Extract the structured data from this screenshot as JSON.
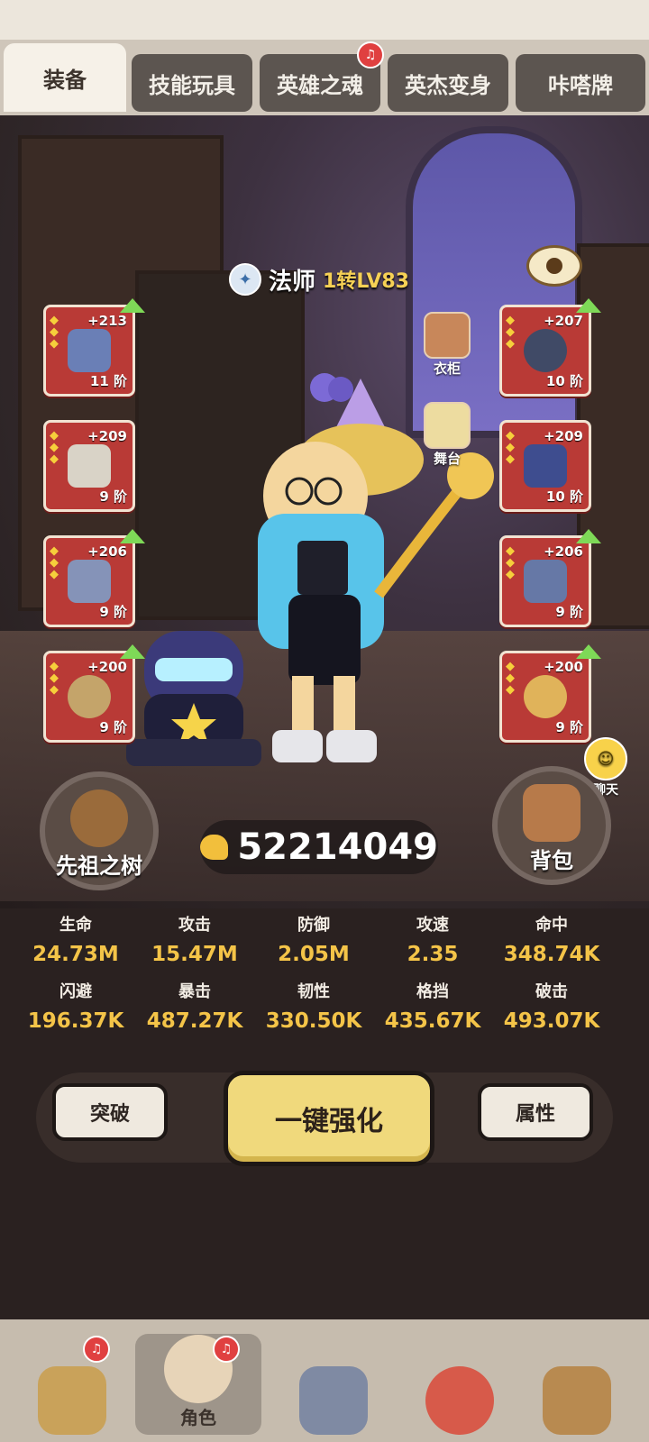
{
  "tabs": [
    {
      "label": "装备",
      "active": true,
      "badge": false
    },
    {
      "label": "技能玩具",
      "active": false,
      "badge": false
    },
    {
      "label": "英雄之魂",
      "active": false,
      "badge": true
    },
    {
      "label": "英杰变身",
      "active": false,
      "badge": false
    },
    {
      "label": "咔嗒牌",
      "active": false,
      "badge": false
    }
  ],
  "character": {
    "class_name": "法师",
    "level": "1转LV83"
  },
  "equipment_left": [
    {
      "plus": "+213",
      "tier": "11 阶",
      "upgradable": true,
      "color": "#6a7fb6"
    },
    {
      "plus": "+209",
      "tier": "9 阶",
      "upgradable": false,
      "color": "#d9d3c7"
    },
    {
      "plus": "+206",
      "tier": "9 阶",
      "upgradable": true,
      "color": "#8593b8"
    },
    {
      "plus": "+200",
      "tier": "9 阶",
      "upgradable": true,
      "color": "#c4a46a"
    }
  ],
  "equipment_right": [
    {
      "plus": "+207",
      "tier": "10 阶",
      "upgradable": true,
      "color": "#404a66"
    },
    {
      "plus": "+209",
      "tier": "10 阶",
      "upgradable": false,
      "color": "#3e4d8f"
    },
    {
      "plus": "+206",
      "tier": "9 阶",
      "upgradable": true,
      "color": "#6678a6"
    },
    {
      "plus": "+200",
      "tier": "9 阶",
      "upgradable": true,
      "color": "#e0b35a"
    }
  ],
  "side_buttons": {
    "wardrobe": "衣柜",
    "stage": "舞台"
  },
  "round_buttons": {
    "tree": "先祖之树",
    "bag": "背包"
  },
  "power": {
    "value": "52214049"
  },
  "chat": {
    "label": "聊天"
  },
  "stats": [
    {
      "label": "生命",
      "value": "24.73M"
    },
    {
      "label": "攻击",
      "value": "15.47M"
    },
    {
      "label": "防御",
      "value": "2.05M"
    },
    {
      "label": "攻速",
      "value": "2.35"
    },
    {
      "label": "命中",
      "value": "348.74K"
    },
    {
      "label": "闪避",
      "value": "196.37K"
    },
    {
      "label": "暴击",
      "value": "487.27K"
    },
    {
      "label": "韧性",
      "value": "330.50K"
    },
    {
      "label": "格挡",
      "value": "435.67K"
    },
    {
      "label": "破击",
      "value": "493.07K"
    }
  ],
  "actions": {
    "breakthrough": "突破",
    "one_key_enhance": "一键强化",
    "attributes": "属性"
  },
  "bottom_nav": [
    {
      "label": "",
      "active": false,
      "badge": true,
      "color": "#c9a25a"
    },
    {
      "label": "角色",
      "active": true,
      "badge": true,
      "color": "#e7d4b8"
    },
    {
      "label": "",
      "active": false,
      "badge": false,
      "color": "#7f8aa3"
    },
    {
      "label": "",
      "active": false,
      "badge": false,
      "color": "#d75a4a"
    },
    {
      "label": "",
      "active": false,
      "badge": false,
      "color": "#b88a50"
    }
  ],
  "colors": {
    "accent_gold": "#f4c448",
    "slot_red": "#b93a36",
    "upgrade_green": "#7ed957"
  }
}
